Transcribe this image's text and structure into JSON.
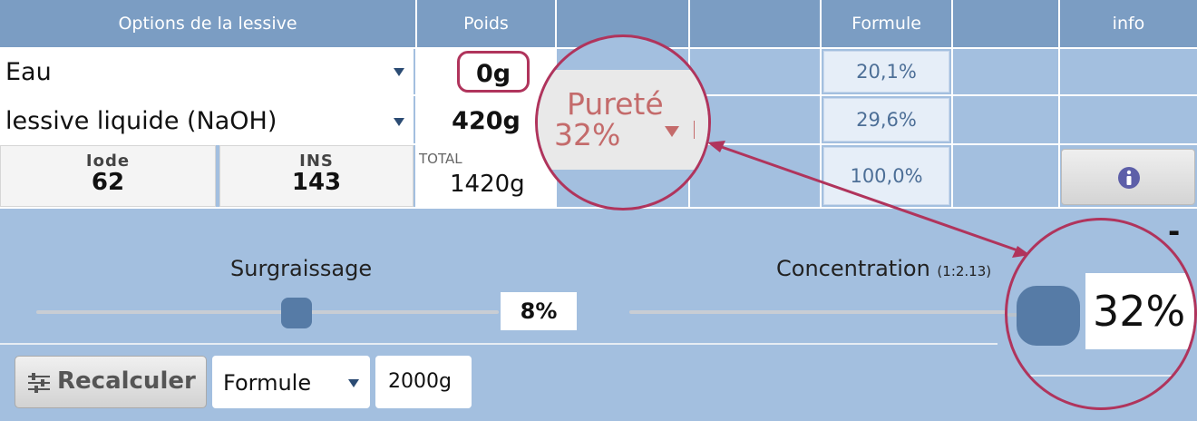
{
  "header": {
    "options": "Options de la lessive",
    "poids": "Poids",
    "formule": "Formule",
    "info": "info"
  },
  "rows": [
    {
      "name": "Eau",
      "weight": "0g",
      "percent": "20,1%"
    },
    {
      "name": "lessive liquide (NaOH)",
      "weight": "420g",
      "percent": "29,6%"
    }
  ],
  "stats": {
    "iode_label": "Iode",
    "iode_value": "62",
    "ins_label": "INS",
    "ins_value": "143",
    "total_label": "TOTAL",
    "total_value": "1420g",
    "total_percent": "100,0%"
  },
  "purity": {
    "label": "Pureté",
    "value": "32%"
  },
  "surgraissage": {
    "label": "Surgraissage",
    "value": "8%",
    "level": 0.56
  },
  "concentration": {
    "label": "Concentration",
    "ratio": "(1:2.13)",
    "value": "32%",
    "minus": "-"
  },
  "bottom": {
    "recalc": "Recalculer",
    "mode": "Formule",
    "total": "2000g"
  },
  "colors": {
    "header": "#7b9dc3",
    "background": "#a3bfdf",
    "accent": "#567ba6",
    "highlight": "#b0345c"
  },
  "icons": [
    "chevron-down-icon",
    "info-icon",
    "sliders-icon"
  ]
}
